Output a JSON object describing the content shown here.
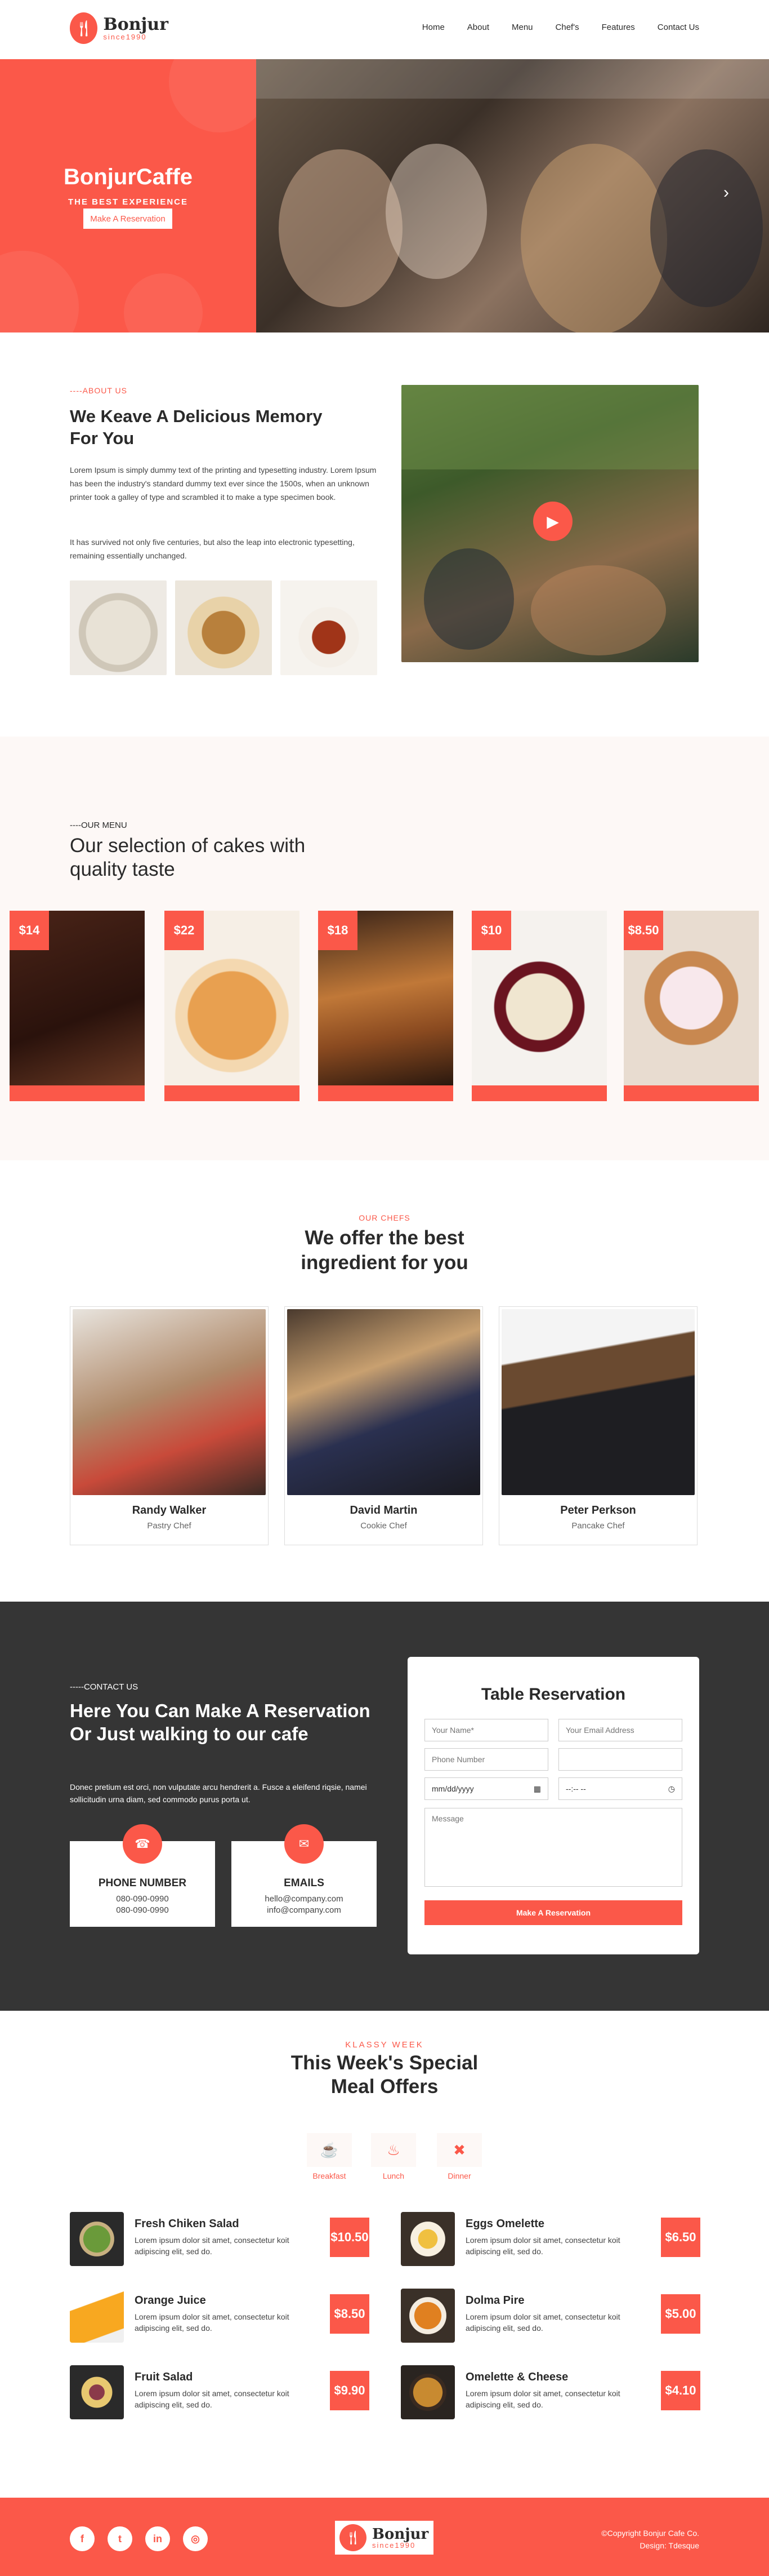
{
  "brand": {
    "name": "Bonjur",
    "tagline": "since1990",
    "accent": "#fb5849"
  },
  "nav": {
    "items": [
      "Home",
      "About",
      "Menu",
      "Chef's",
      "Features",
      "Contact Us"
    ]
  },
  "hero": {
    "title": "BonjurCaffe",
    "subtitle": "THE BEST EXPERIENCE",
    "button_label": "Make A Reservation",
    "next_icon": "chevron-right-icon"
  },
  "about": {
    "label": "----ABOUT US",
    "heading": "We Keave A Delicious Memory For You",
    "paragraph1": "Lorem Ipsum is simply dummy text of the printing and typesetting industry. Lorem Ipsum has been the industry's standard dummy text ever since the 1500s, when an unknown printer took a galley of type and scrambled it to make a type specimen book.",
    "paragraph2": "It has survived not only five centuries, but also the leap into electronic typesetting, remaining essentially unchanged.",
    "play_icon": "play-icon"
  },
  "menu": {
    "label": "----OUR MENU",
    "heading": "Our selection of cakes with quality taste",
    "prices": [
      "$14",
      "$22",
      "$18",
      "$10",
      "$8.50"
    ]
  },
  "chefs": {
    "label": "OUR CHEFS",
    "heading": "We offer the best ingredient for you",
    "people": [
      {
        "name": "Randy Walker",
        "role": "Pastry Chef"
      },
      {
        "name": "David Martin",
        "role": "Cookie Chef"
      },
      {
        "name": "Peter Perkson",
        "role": "Pancake Chef"
      }
    ]
  },
  "contact": {
    "label": "-----CONTACT US",
    "heading": "Here You Can Make A Reservation Or Just walking to our cafe",
    "paragraph": "Donec pretium est orci, non vulputate arcu hendrerit a. Fusce a eleifend riqsie, namei sollicitudin urna diam, sed commodo purus porta ut.",
    "phone": {
      "title": "PHONE NUMBER",
      "lines": [
        "080-090-0990",
        "080-090-0990"
      ]
    },
    "email": {
      "title": "EMAILS",
      "lines": [
        "hello@company.com",
        "info@company.com"
      ]
    }
  },
  "reservation": {
    "title": "Table Reservation",
    "name_placeholder": "Your Name*",
    "email_placeholder": "Your Email Address",
    "phone_placeholder": "Phone Number",
    "date_placeholder": "mm/dd/yyyy",
    "time_placeholder": "--:-- --",
    "message_placeholder": "Message",
    "button_label": "Make A Reservation"
  },
  "offers": {
    "label": "KLASSY WEEK",
    "heading": "This Week's Special Meal Offers",
    "tabs": [
      "Breakfast",
      "Lunch",
      "Dinner"
    ],
    "items": [
      {
        "name": "Fresh Chiken Salad",
        "desc": "Lorem ipsum dolor sit amet, consectetur koit adipiscing elit, sed do.",
        "price": "$10.50"
      },
      {
        "name": "Eggs Omelette",
        "desc": "Lorem ipsum dolor sit amet, consectetur koit adipiscing elit, sed do.",
        "price": "$6.50"
      },
      {
        "name": "Orange Juice",
        "desc": "Lorem ipsum dolor sit amet, consectetur koit adipiscing elit, sed do.",
        "price": "$8.50"
      },
      {
        "name": "Dolma Pire",
        "desc": "Lorem ipsum dolor sit amet, consectetur koit adipiscing elit, sed do.",
        "price": "$5.00"
      },
      {
        "name": "Fruit Salad",
        "desc": "Lorem ipsum dolor sit amet, consectetur koit adipiscing elit, sed do.",
        "price": "$9.90"
      },
      {
        "name": "Omelette & Cheese",
        "desc": "Lorem ipsum dolor sit amet, consectetur koit adipiscing elit, sed do.",
        "price": "$4.10"
      }
    ]
  },
  "footer": {
    "copyright": "©Copyright Bonjur Cafe Co.",
    "design": "Design: Tdesque",
    "social_icons": [
      "facebook-icon",
      "twitter-icon",
      "linkedin-icon",
      "instagram-icon"
    ]
  }
}
